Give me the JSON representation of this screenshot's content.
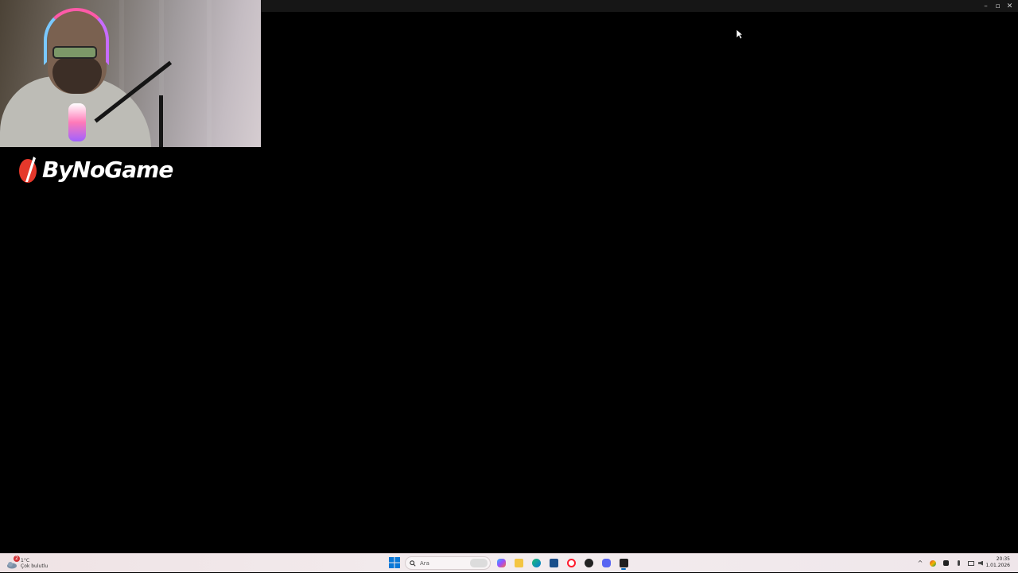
{
  "window": {
    "controls": {
      "minimize": "–",
      "maximize": "▫",
      "close": "✕"
    }
  },
  "overlay": {
    "logo_text": "ByNoGame",
    "logo_color": "#e5382b"
  },
  "taskbar": {
    "weather": {
      "temperature": "1°C",
      "condition": "Çok bulutlu",
      "badge": "2"
    },
    "search": {
      "placeholder": "Ara"
    },
    "apps": [
      "start-icon",
      "copilot-icon",
      "file-explorer-icon",
      "edge-icon",
      "store-icon",
      "opera-icon",
      "app-icon",
      "discord-icon",
      "terminal-icon"
    ],
    "tray": {
      "overflow": "^"
    },
    "clock": {
      "time": "20:35",
      "date": "1.01.2026"
    }
  }
}
